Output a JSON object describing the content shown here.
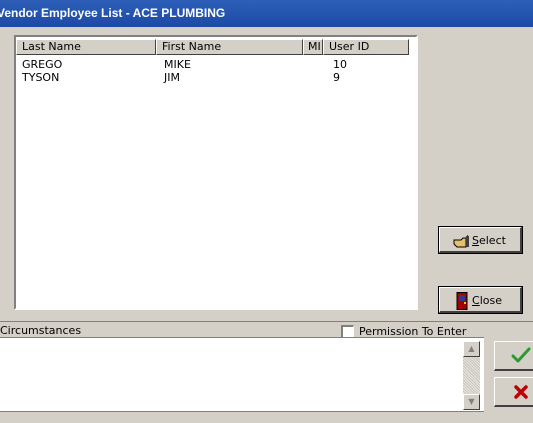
{
  "window": {
    "title": "Vendor Employee List - ACE PLUMBING"
  },
  "list": {
    "columns": [
      "Last Name",
      "First Name",
      "MI",
      "User ID"
    ],
    "rows": [
      {
        "last": "GREGO",
        "first": "MIKE",
        "mi": "",
        "user_id": "10"
      },
      {
        "last": "TYSON",
        "first": "JIM",
        "mi": "",
        "user_id": "9"
      }
    ]
  },
  "buttons": {
    "select": {
      "mnemonic": "S",
      "rest": "elect",
      "icon": "select-hand-icon"
    },
    "close": {
      "mnemonic": "C",
      "rest": "lose",
      "icon": "door-icon"
    },
    "ok_icon": "check-icon",
    "cancel_icon": "x-icon"
  },
  "circumstances": {
    "label": "Circumstances",
    "value": ""
  },
  "permission": {
    "label": "Permission To Enter",
    "checked": false
  },
  "colors": {
    "titlebar": "#1c4aa6",
    "face": "#d4d0c8",
    "ok": "#2e9a2e",
    "cancel": "#c00000"
  }
}
